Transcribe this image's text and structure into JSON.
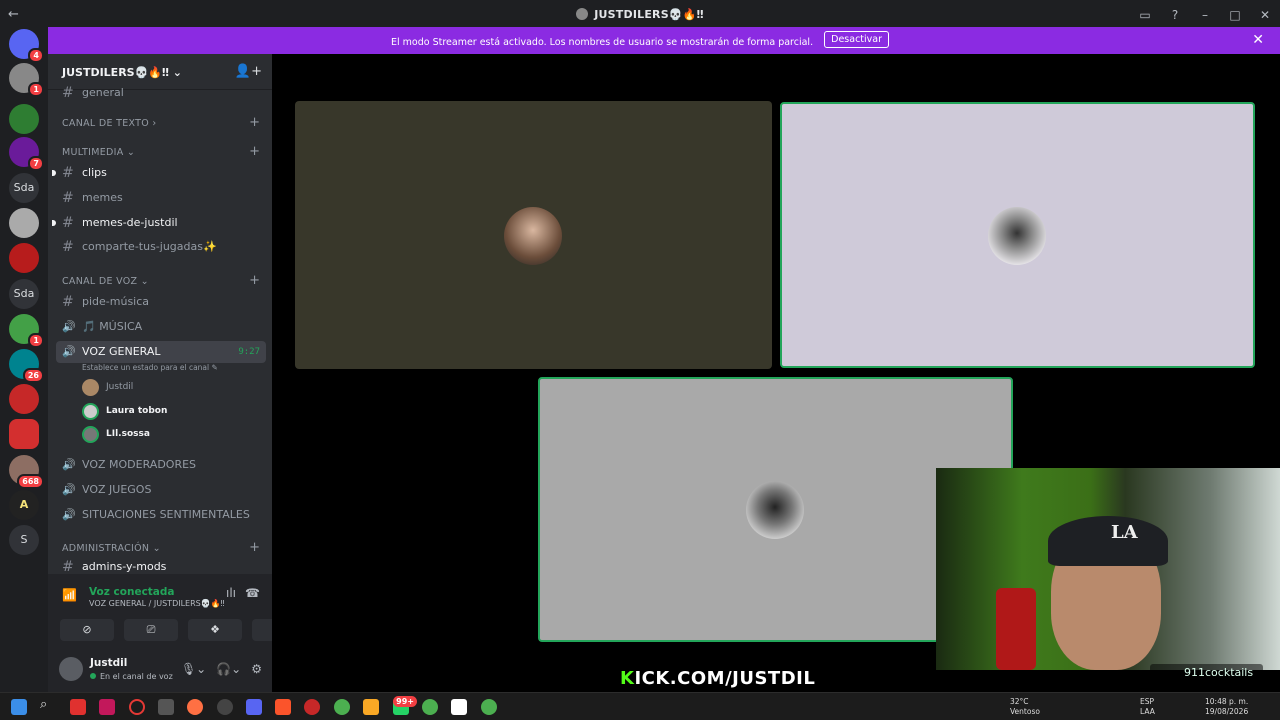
{
  "window": {
    "title": "JUSTDILERS💀🔥‼",
    "back_icon": "←"
  },
  "banner": {
    "text": "El modo Streamer está activado. Los nombres de usuario se mostrarán de forma parcial.",
    "button": "Desactivar",
    "close": "✕",
    "color": "#8b2be2"
  },
  "servers": [
    {
      "label": "",
      "badge": "4"
    },
    {
      "label": "",
      "badge": "1"
    },
    {
      "label": "",
      "badge": ""
    },
    {
      "label": "",
      "badge": "7"
    },
    {
      "label": "Sda",
      "badge": ""
    },
    {
      "label": "",
      "badge": ""
    },
    {
      "label": "",
      "badge": ""
    },
    {
      "label": "Sda",
      "badge": ""
    },
    {
      "label": "",
      "badge": "1"
    },
    {
      "label": "",
      "badge": "26"
    },
    {
      "label": "",
      "badge": ""
    },
    {
      "label": "",
      "badge": ""
    },
    {
      "label": "",
      "badge": "668"
    },
    {
      "label": "A",
      "badge": ""
    },
    {
      "label": "S",
      "badge": ""
    }
  ],
  "guild": {
    "name": "JUSTDILERS💀🔥‼",
    "chevron": "⌄"
  },
  "channels": {
    "top_partial": "general",
    "cat_text": "CANAL DE TEXTO",
    "cat_media": "MULTIMEDIA",
    "clips": "clips",
    "memes": "memes",
    "memes_de_justdil": "memes-de-justdil",
    "comparte": "comparte-tus-jugadas✨",
    "cat_voice": "CANAL DE VOZ",
    "pide_musica": "pide-música",
    "musica": "🎵 MÚSICA",
    "voz_general": "VOZ GENERAL",
    "voz_general_time": "9:27",
    "status_hint": "Establece un estado para el canal",
    "voice_users": [
      "Justdil",
      "Laura tobon",
      "LIl.sossa"
    ],
    "voz_moderadores": "VOZ MODERADORES",
    "voz_juegos": "VOZ JUEGOS",
    "situaciones": "SITUACIONES SENTIMENTALES",
    "cat_admin": "ADMINISTRACIÓN",
    "admins": "admins-y-mods"
  },
  "voice_panel": {
    "title": "Voz conectada",
    "subtitle": "VOZ GENERAL / JUSTDILERS💀🔥‼"
  },
  "user": {
    "name": "Justdil",
    "status": "En el canal de voz"
  },
  "overlay": {
    "kick_prefix": "K",
    "kick_rest": "ICK.COM/JUSTDIL",
    "cocktails": "911cocktails",
    "brand_color": "#53fc18"
  },
  "taskbar": {
    "weather_temp": "32°C",
    "weather_desc": "Ventoso",
    "lang_top": "ESP",
    "lang_bottom": "LAA",
    "time": "10:48 p. m.",
    "date": "19/08/2026",
    "badge_whatsapp": "99+"
  }
}
